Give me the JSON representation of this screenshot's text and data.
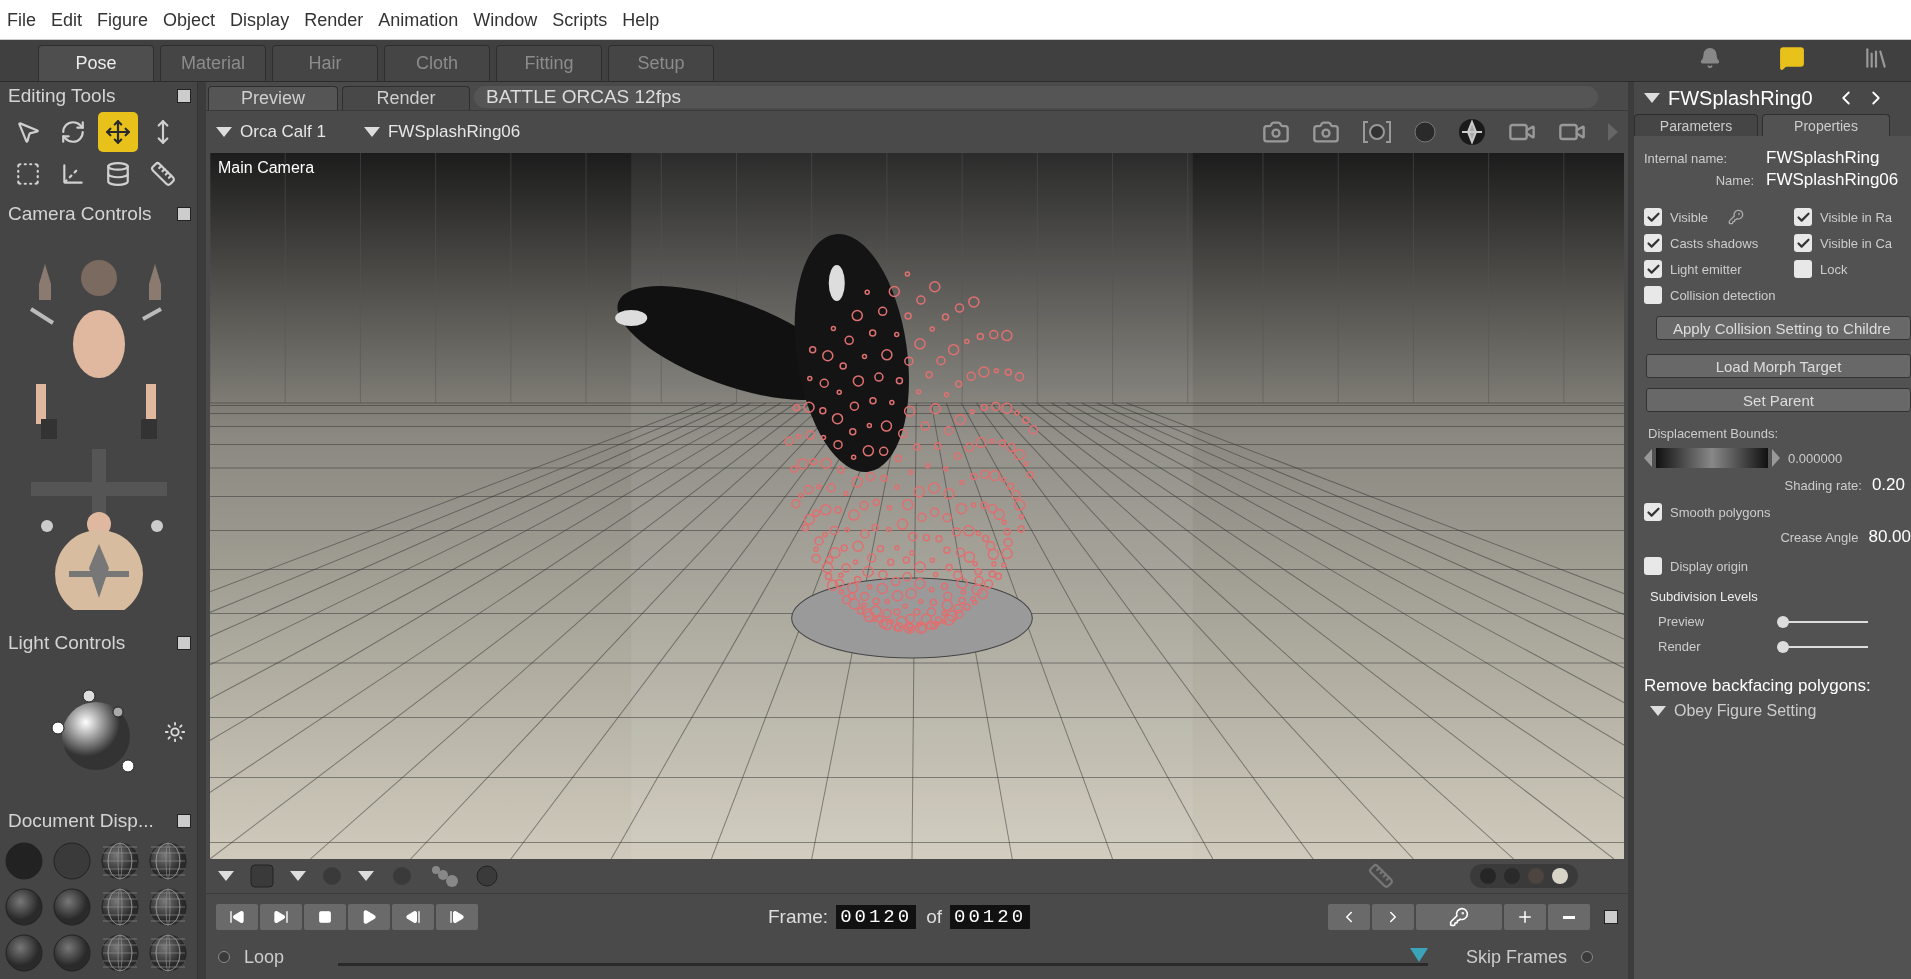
{
  "menu": [
    "File",
    "Edit",
    "Figure",
    "Object",
    "Display",
    "Render",
    "Animation",
    "Window",
    "Scripts",
    "Help"
  ],
  "rooms": [
    {
      "label": "Pose",
      "selected": true
    },
    {
      "label": "Material",
      "selected": false
    },
    {
      "label": "Hair",
      "selected": false
    },
    {
      "label": "Cloth",
      "selected": false
    },
    {
      "label": "Fitting",
      "selected": false
    },
    {
      "label": "Setup",
      "selected": false
    }
  ],
  "editing_tools": {
    "title": "Editing Tools",
    "tools": [
      {
        "selected": false
      },
      {
        "selected": false
      },
      {
        "selected": true
      },
      {
        "selected": false
      },
      {
        "selected": false
      },
      {
        "selected": false
      },
      {
        "selected": false
      },
      {
        "selected": false
      }
    ]
  },
  "camera_controls": {
    "title": "Camera Controls"
  },
  "light_controls": {
    "title": "Light Controls"
  },
  "document_display": {
    "title": "Document Disp..."
  },
  "viewport": {
    "tabs": [
      {
        "label": "Preview",
        "selected": true
      },
      {
        "label": "Render",
        "selected": false
      }
    ],
    "title": "BATTLE ORCAS 12fps",
    "figure": "Orca Calf 1",
    "actor": "FWSplashRing06",
    "camera_label": "Main Camera",
    "swatches": [
      {
        "color": "#262626"
      },
      {
        "color": "#2a2a2a"
      },
      {
        "color": "#4e4440"
      },
      {
        "color": "#d8d4c8"
      }
    ]
  },
  "playback": {
    "frame_label": "Frame:",
    "frame": "00120",
    "of_label": "of",
    "total": "00120",
    "loop_label": "Loop",
    "loop_on": false,
    "skip_label": "Skip Frames",
    "skip_on": false,
    "level": 1
  },
  "properties": {
    "title": "FWSplashRing0",
    "tabs": [
      {
        "label": "Parameters",
        "selected": false
      },
      {
        "label": "Properties",
        "selected": true
      }
    ],
    "internal_name_label": "Internal name:",
    "internal_name": "FWSplashRing",
    "name_label": "Name:",
    "name": "FWSplashRing06",
    "checks": [
      {
        "label": "Visible",
        "checked": true
      },
      {
        "label": "Visible in Ra",
        "checked": true
      },
      {
        "label": "Casts shadows",
        "checked": true
      },
      {
        "label": "Visible in Ca",
        "checked": true
      },
      {
        "label": "Light emitter",
        "checked": true
      },
      {
        "label": "Lock",
        "checked": false
      }
    ],
    "collision": {
      "label": "Collision detection",
      "checked": false
    },
    "apply_button": "Apply Collision Setting to Childre",
    "buttons": [
      "Load Morph Target",
      "Set Parent"
    ],
    "displacement_label": "Displacement Bounds:",
    "displacement_value": "0.000000",
    "shading_label": "Shading rate:",
    "shading_value": "0.20",
    "smooth": {
      "label": "Smooth polygons",
      "checked": true
    },
    "crease_label": "Crease Angle",
    "crease_value": "80.00",
    "origin": {
      "label": "Display origin",
      "checked": false
    },
    "subdivision_title": "Subdivision Levels",
    "sliders": [
      {
        "label": "Preview",
        "level": 0.05
      },
      {
        "label": "Render",
        "level": 0.05
      }
    ],
    "backface_label": "Remove backfacing polygons:",
    "backface_value": "Obey Figure Setting"
  }
}
